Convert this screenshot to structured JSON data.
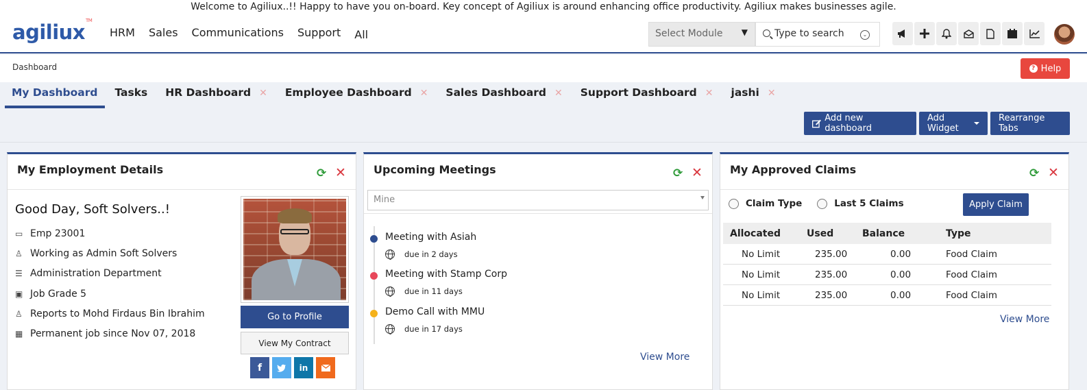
{
  "welcome": "Welcome to Agiliux..!! Happy to have you on-board. Key concept of Agiliux is around enhancing office productivity. Agiliux makes businesses agile.",
  "brand": {
    "name": "agiliux",
    "tm": "TM",
    "color": "#2e5aa8"
  },
  "menu": [
    "HRM",
    "Sales",
    "Communications",
    "Support",
    "All"
  ],
  "module_select": {
    "value": "Select Module"
  },
  "search": {
    "placeholder": "Type to search"
  },
  "toolbar_icons": [
    "megaphone-icon",
    "plus-icon",
    "bell-icon",
    "inbox-icon",
    "document-icon",
    "calendar-icon",
    "chart-icon"
  ],
  "breadcrumb": "Dashboard",
  "help_label": "Help",
  "tabs": [
    {
      "label": "My Dashboard",
      "active": true,
      "closable": false
    },
    {
      "label": "Tasks",
      "closable": false
    },
    {
      "label": "HR Dashboard",
      "closable": true
    },
    {
      "label": "Employee Dashboard",
      "closable": true
    },
    {
      "label": "Sales Dashboard",
      "closable": true
    },
    {
      "label": "Support Dashboard",
      "closable": true
    },
    {
      "label": "jashi",
      "closable": true
    }
  ],
  "actions": {
    "add_dashboard": "Add new dashboard",
    "add_widget": "Add Widget",
    "rearrange": "Rearrange Tabs"
  },
  "employment": {
    "title": "My Employment Details",
    "greeting": "Good Day, Soft Solvers..!",
    "rows": [
      {
        "icon": "id-card-icon",
        "text": "Emp 23001"
      },
      {
        "icon": "user-icon",
        "text": "Working as Admin Soft Solvers"
      },
      {
        "icon": "list-icon",
        "text": "Administration Department"
      },
      {
        "icon": "briefcase-icon",
        "text": "Job Grade 5"
      },
      {
        "icon": "user-icon",
        "text": "Reports to Mohd Firdaus Bin Ibrahim"
      },
      {
        "icon": "calendar-icon",
        "text": "Permanent job since Nov 07, 2018"
      }
    ],
    "profile_button": "Go to Profile",
    "contract_button": "View My Contract"
  },
  "meetings": {
    "title": "Upcoming Meetings",
    "filter": "Mine",
    "items": [
      {
        "name": "Meeting with Asiah",
        "due": "due in 2 days",
        "color": "#2e4d8f"
      },
      {
        "name": "Meeting with Stamp Corp",
        "due": "due in 11 days",
        "color": "#e8475a"
      },
      {
        "name": "Demo Call with MMU",
        "due": "due in 17 days",
        "color": "#f5b21b"
      }
    ],
    "view_more": "View More"
  },
  "claims": {
    "title": "My Approved Claims",
    "radio_1": "Claim Type",
    "radio_2": "Last 5 Claims",
    "apply_button": "Apply Claim",
    "headers": [
      "Allocated",
      "Used",
      "Balance",
      "Type"
    ],
    "rows": [
      [
        "No Limit",
        "235.00",
        "0.00",
        "Food Claim"
      ],
      [
        "No Limit",
        "235.00",
        "0.00",
        "Food Claim"
      ],
      [
        "No Limit",
        "235.00",
        "0.00",
        "Food Claim"
      ]
    ],
    "view_more": "View More"
  },
  "colors": {
    "primary": "#2e4d8f",
    "danger": "#e8473e",
    "refresh": "#2f9b3a"
  }
}
